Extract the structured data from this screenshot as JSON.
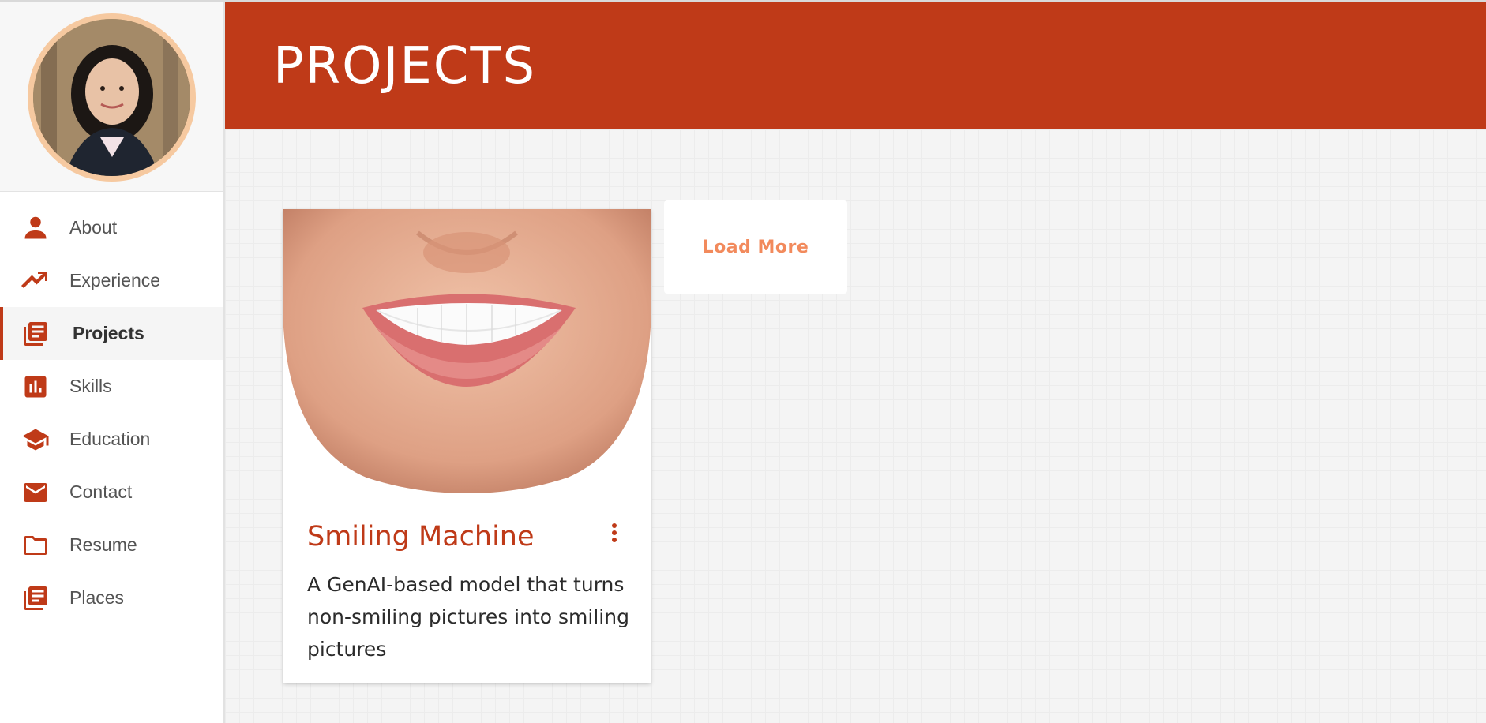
{
  "header": {
    "title": "PROJECTS"
  },
  "sidebar": {
    "items": [
      {
        "label": "About",
        "icon": "person-icon"
      },
      {
        "label": "Experience",
        "icon": "trending-up-icon"
      },
      {
        "label": "Projects",
        "icon": "library-books-icon",
        "active": true
      },
      {
        "label": "Skills",
        "icon": "bar-chart-icon"
      },
      {
        "label": "Education",
        "icon": "graduation-cap-icon"
      },
      {
        "label": "Contact",
        "icon": "mail-icon"
      },
      {
        "label": "Resume",
        "icon": "folder-icon"
      },
      {
        "label": "Places",
        "icon": "library-books-icon"
      }
    ]
  },
  "projects": [
    {
      "title": "Smiling Machine",
      "description": "A GenAI-based model that turns non-smiling pictures into smiling pictures"
    }
  ],
  "load_more_label": "Load More",
  "colors": {
    "accent": "#bf3a18",
    "load_more_text": "#f28a5c",
    "avatar_ring": "#f6c9a0"
  }
}
